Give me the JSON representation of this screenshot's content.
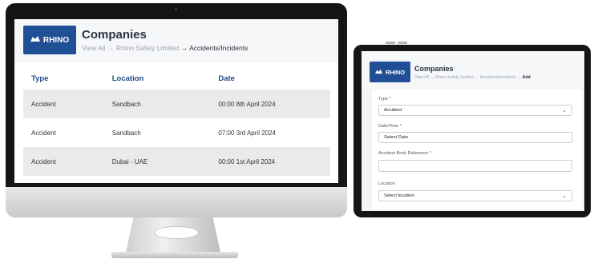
{
  "monitor": {
    "brand": "RHINO",
    "title": "Companies",
    "breadcrumb": {
      "part1": "View All",
      "sep": "→",
      "part2": "Rhino Safety Limited",
      "current": "Accidents/Incidents"
    },
    "table": {
      "headers": [
        "Type",
        "Location",
        "Date"
      ],
      "rows": [
        [
          "Accident",
          "Sandbach",
          "00:00 8th April 2024"
        ],
        [
          "Accident",
          "Sandbach",
          "07:00 3rd April 2024"
        ],
        [
          "Accident",
          "Dubai - UAE",
          "00:00 1st April 2024"
        ]
      ]
    }
  },
  "tablet": {
    "brand": "RHINO",
    "title": "Companies",
    "breadcrumb": {
      "part1": "View All",
      "sep": "→",
      "part2": "Rhino Safety Limited",
      "part3": "Accidents/Incidents",
      "current": "Add"
    },
    "form": {
      "type_label": "Type *",
      "type_value": "Accident",
      "datetime_label": "Date/Time *",
      "datetime_value": "Select Date",
      "book_ref_label": "Accident Book Reference *",
      "book_ref_value": "",
      "location_label": "Location",
      "location_value": "Select location"
    }
  },
  "colors": {
    "brand": "#214f95",
    "header_text": "#244a86",
    "row_alt": "#e9eaec"
  }
}
